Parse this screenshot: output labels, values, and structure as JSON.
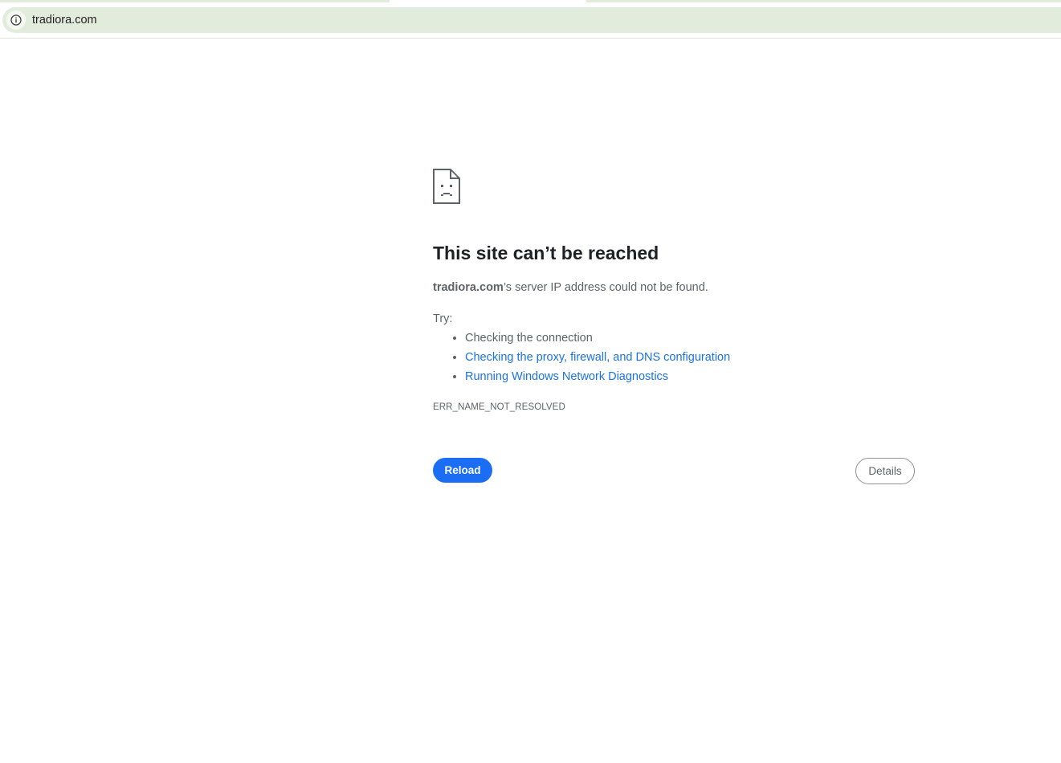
{
  "browser": {
    "address_bar": {
      "url": "tradiora.com",
      "site_info_icon": "info-icon"
    }
  },
  "error_page": {
    "icon": "sad-page-icon",
    "title": "This site can’t be reached",
    "description": {
      "host": "tradiora.com",
      "suffix": "’s server IP address could not be found."
    },
    "try_label": "Try:",
    "suggestions": [
      {
        "text": "Checking the connection",
        "is_link": false
      },
      {
        "text": "Checking the proxy, firewall, and DNS configuration",
        "is_link": true
      },
      {
        "text": "Running Windows Network Diagnostics",
        "is_link": true
      }
    ],
    "error_code": "ERR_NAME_NOT_RESOLVED",
    "buttons": {
      "reload": "Reload",
      "details": "Details"
    }
  },
  "colors": {
    "accent_blue": "#1a73e8",
    "reload_button": "#1b6ef3",
    "omnibox_bg": "#e2ecdd",
    "title_text": "#202124",
    "body_text": "#5f6368"
  }
}
